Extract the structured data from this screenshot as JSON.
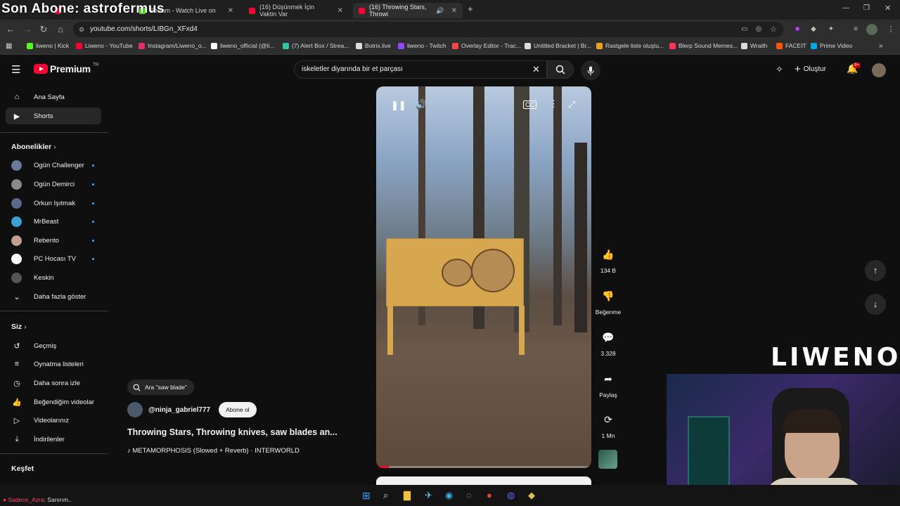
{
  "overlay": {
    "text": "Son Abone: astrofermus"
  },
  "tabs": [
    {
      "title": ""
    },
    {
      "title": "Stream - Watch Live on"
    },
    {
      "title": "(16) Düşünmek İçin Vaktin Var"
    },
    {
      "title": "(16) Throwing Stars, Throwi"
    }
  ],
  "address": {
    "url": "youtube.com/shorts/LIBGn_XFxd4"
  },
  "bookmarks": [
    {
      "label": "liweno | Kick",
      "color": "#53fc18"
    },
    {
      "label": "Liweno - YouTube",
      "color": "#ff0033"
    },
    {
      "label": "Instagram/Liweno_o...",
      "color": "#e1306c"
    },
    {
      "label": "liweno_official (@li...",
      "color": "#ffffff"
    },
    {
      "label": "(7) Alert Box / Strea...",
      "color": "#31c3a2"
    },
    {
      "label": "Botrix.live",
      "color": "#dddddd"
    },
    {
      "label": "liweno - Twitch",
      "color": "#9146ff"
    },
    {
      "label": "Overlay Editor - Trac...",
      "color": "#ff4444"
    },
    {
      "label": "Untitled Bracket | Br...",
      "color": "#dddddd"
    },
    {
      "label": "Rastgele liste oluştu...",
      "color": "#f0a020"
    },
    {
      "label": "Blerp Sound Memes...",
      "color": "#ff3355"
    },
    {
      "label": "Wraith",
      "color": "#dddddd"
    },
    {
      "label": "FACEIT",
      "color": "#ff5500"
    },
    {
      "label": "Prime Video",
      "color": "#00a8e1"
    }
  ],
  "header": {
    "logo_text": "Premium",
    "logo_region": "TR",
    "search_value": "iskeletler diyarında bir et parçası",
    "create_label": "Oluştur",
    "notif_count": "9+"
  },
  "sidebar": {
    "items": [
      {
        "label": "Ana Sayfa",
        "icon": "home-icon"
      },
      {
        "label": "Shorts",
        "icon": "shorts-icon"
      }
    ],
    "subs_heading": "Abonelikler",
    "subs": [
      {
        "label": "Ogün Challenger",
        "color": "#6a7a9a"
      },
      {
        "label": "Ogün Demirci",
        "color": "#8a8a8a"
      },
      {
        "label": "Orkun Işıtmak",
        "color": "#5a6a8a"
      },
      {
        "label": "MrBeast",
        "color": "#3aa0d0"
      },
      {
        "label": "Rebento",
        "color": "#c0a090"
      },
      {
        "label": "PC Hocası TV",
        "color": "#ffffff"
      },
      {
        "label": "Keskin",
        "color": "#555555"
      }
    ],
    "show_more": "Daha fazla göster",
    "you_heading": "Siz",
    "you_items": [
      {
        "label": "Geçmiş"
      },
      {
        "label": "Oynatma listeleri"
      },
      {
        "label": "Daha sonra izle"
      },
      {
        "label": "Beğendiğim videolar"
      },
      {
        "label": "Videolarınız"
      },
      {
        "label": "İndirilenler"
      }
    ],
    "explore_heading": "Keşfet"
  },
  "short": {
    "search_chip": "Ara \"saw blade\"",
    "channel": "@ninja_gabriel777",
    "subscribe_label": "Abone ol",
    "title": "Throwing Stars, Throwing knives, saw blades an...",
    "music": "METAMORPHOSIS (Slowed + Reverb) · INTERWORLD",
    "progress": 0.06
  },
  "actions": {
    "likes": "134 B",
    "dislike_label": "Beğenme",
    "comments": "3.328",
    "share_label": "Paylaş",
    "remix_label": "1 Mn"
  },
  "stream": {
    "brand": "LIWENO",
    "chat_user": "Sadece_Azra",
    "chat_text": ": Sanırım.."
  }
}
